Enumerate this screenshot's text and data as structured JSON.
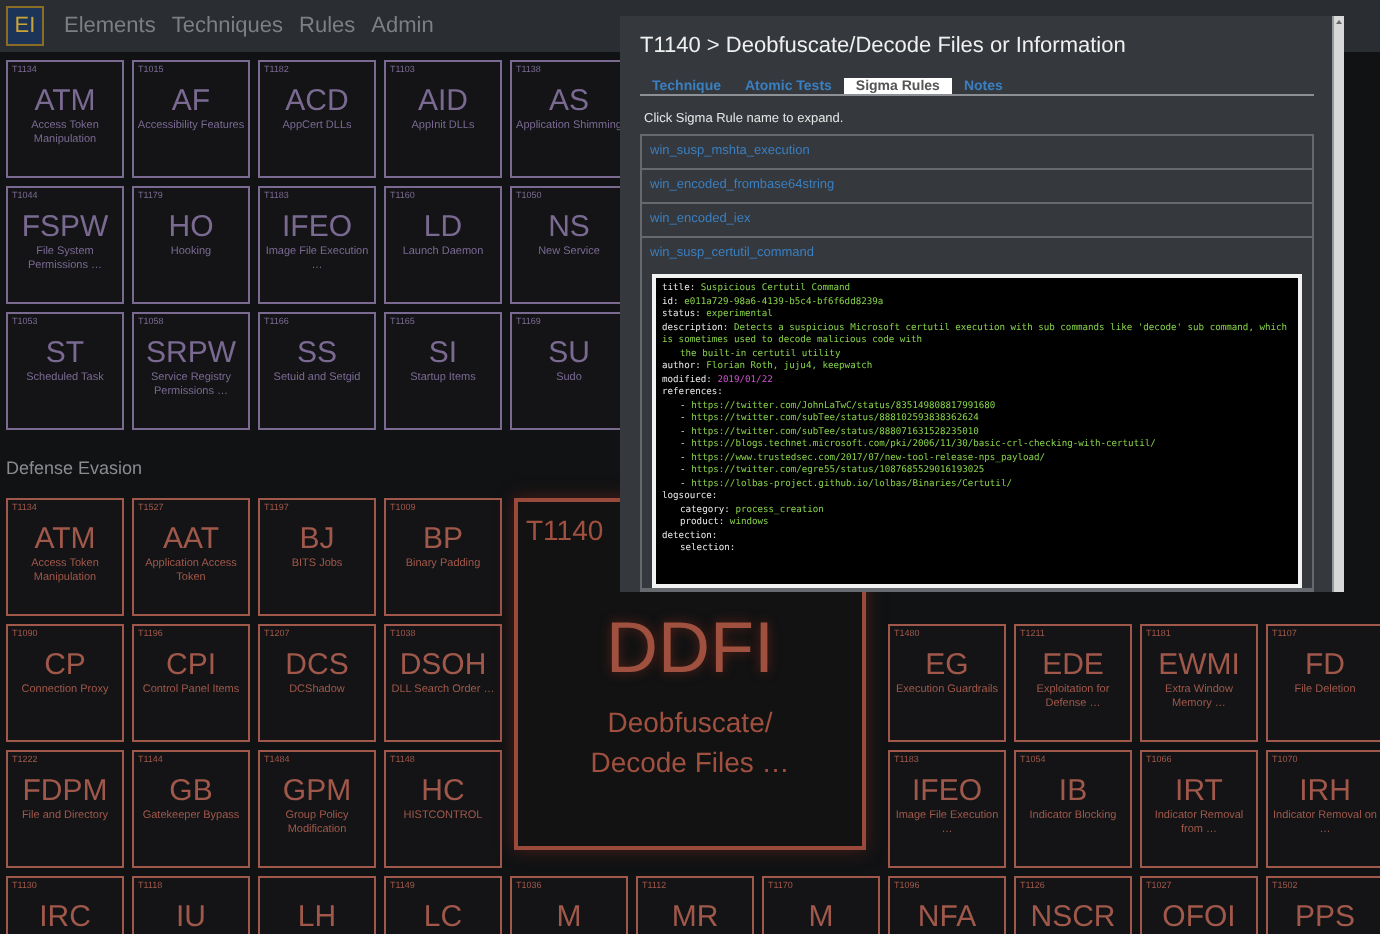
{
  "nav": {
    "logo": "EI",
    "items": [
      "Elements",
      "Techniques",
      "Rules",
      "Admin"
    ]
  },
  "sections": [
    {
      "color": "#7a6a92",
      "rows": [
        {
          "left": [
            {
              "id": "T1134",
              "abbr": "ATM",
              "name": "Access Token Manipulation"
            },
            {
              "id": "T1015",
              "abbr": "AF",
              "name": "Accessibility Features"
            },
            {
              "id": "T1182",
              "abbr": "ACD",
              "name": "AppCert DLLs"
            },
            {
              "id": "T1103",
              "abbr": "AID",
              "name": "AppInit DLLs"
            },
            {
              "id": "T1138",
              "abbr": "AS",
              "name": "Application Shimming"
            }
          ]
        },
        {
          "left": [
            {
              "id": "T1044",
              "abbr": "FSPW",
              "name": "File System Permissions …"
            },
            {
              "id": "T1179",
              "abbr": "HO",
              "name": "Hooking"
            },
            {
              "id": "T1183",
              "abbr": "IFEO",
              "name": "Image File Execution …"
            },
            {
              "id": "T1160",
              "abbr": "LD",
              "name": "Launch Daemon"
            },
            {
              "id": "T1050",
              "abbr": "NS",
              "name": "New Service"
            }
          ]
        },
        {
          "left": [
            {
              "id": "T1053",
              "abbr": "ST",
              "name": "Scheduled Task"
            },
            {
              "id": "T1058",
              "abbr": "SRPW",
              "name": "Service Registry Permissions …"
            },
            {
              "id": "T1166",
              "abbr": "SS",
              "name": "Setuid and Setgid"
            },
            {
              "id": "T1165",
              "abbr": "SI",
              "name": "Startup Items"
            },
            {
              "id": "T1169",
              "abbr": "SU",
              "name": "Sudo"
            }
          ]
        }
      ]
    },
    {
      "heading": "Defense Evasion",
      "color": "#a0584a",
      "rows": [
        {
          "left": [
            {
              "id": "T1134",
              "abbr": "ATM",
              "name": "Access Token Manipulation"
            },
            {
              "id": "T1527",
              "abbr": "AAT",
              "name": "Application Access Token"
            },
            {
              "id": "T1197",
              "abbr": "BJ",
              "name": "BITS Jobs"
            },
            {
              "id": "T1009",
              "abbr": "BP",
              "name": "Binary Padding"
            }
          ]
        },
        {
          "left": [
            {
              "id": "T1090",
              "abbr": "CP",
              "name": "Connection Proxy"
            },
            {
              "id": "T1196",
              "abbr": "CPI",
              "name": "Control Panel Items"
            },
            {
              "id": "T1207",
              "abbr": "DCS",
              "name": "DCShadow"
            },
            {
              "id": "T1038",
              "abbr": "DSOH",
              "name": "DLL Search Order …"
            }
          ],
          "right": [
            {
              "id": "T1480",
              "abbr": "EG",
              "name": "Execution Guardrails"
            },
            {
              "id": "T1211",
              "abbr": "EDE",
              "name": "Exploitation for Defense …"
            },
            {
              "id": "T1181",
              "abbr": "EWMI",
              "name": "Extra Window Memory …"
            },
            {
              "id": "T1107",
              "abbr": "FD",
              "name": "File Deletion"
            }
          ]
        },
        {
          "left": [
            {
              "id": "T1222",
              "abbr": "FDPM",
              "name": "File and Directory"
            },
            {
              "id": "T1144",
              "abbr": "GB",
              "name": "Gatekeeper Bypass"
            },
            {
              "id": "T1484",
              "abbr": "GPM",
              "name": "Group Policy Modification"
            },
            {
              "id": "T1148",
              "abbr": "HC",
              "name": "HISTCONTROL"
            }
          ],
          "right": [
            {
              "id": "T1183",
              "abbr": "IFEO",
              "name": "Image File Execution …"
            },
            {
              "id": "T1054",
              "abbr": "IB",
              "name": "Indicator Blocking"
            },
            {
              "id": "T1066",
              "abbr": "IRT",
              "name": "Indicator Removal from …"
            },
            {
              "id": "T1070",
              "abbr": "IRH",
              "name": "Indicator Removal on …"
            }
          ]
        },
        {
          "left": [
            {
              "id": "T1130",
              "abbr": "IRC"
            },
            {
              "id": "T1118",
              "abbr": "IU"
            },
            {
              "abbr": "LH"
            },
            {
              "id": "T1149",
              "abbr": "LC"
            },
            {
              "id": "T1036",
              "abbr": "M"
            },
            {
              "id": "T1112",
              "abbr": "MR"
            },
            {
              "id": "T1170",
              "abbr": "M"
            },
            {
              "id": "T1096",
              "abbr": "NFA"
            },
            {
              "id": "T1126",
              "abbr": "NSCR"
            },
            {
              "id": "T1027",
              "abbr": "OFOI"
            },
            {
              "id": "T1502",
              "abbr": "PPS"
            }
          ]
        }
      ]
    }
  ],
  "focused_tile": {
    "id": "T1140",
    "abbr": "DDFI",
    "name": "Deobfuscate/ Decode Files …"
  },
  "dialog": {
    "title": "T1140 > Deobfuscate/Decode Files or Information",
    "tabs": [
      {
        "label": "Technique",
        "selected": false
      },
      {
        "label": "Atomic Tests",
        "selected": false
      },
      {
        "label": "Sigma Rules",
        "selected": true
      },
      {
        "label": "Notes",
        "selected": false
      }
    ],
    "hint": "Click Sigma Rule name to expand.",
    "rules": [
      {
        "name": "win_susp_mshta_execution",
        "expanded": false
      },
      {
        "name": "win_encoded_frombase64string",
        "expanded": false
      },
      {
        "name": "win_encoded_iex",
        "expanded": false
      },
      {
        "name": "win_susp_certutil_command",
        "expanded": true,
        "code": [
          {
            "key": "title:",
            "value": "Suspicious Certutil Command",
            "kind": "string"
          },
          {
            "key": "id:",
            "value": "e011a729-98a6-4139-b5c4-bf6f6dd8239a",
            "kind": "string"
          },
          {
            "key": "status:",
            "value": "experimental",
            "kind": "string"
          },
          {
            "key": "description:",
            "value": "Detects a suspicious Microsoft certutil execution with sub commands like 'decode' sub command, which is sometimes used to decode malicious code with",
            "kind": "string",
            "children": [
              {
                "value": "the built-in certutil utility",
                "kind": "string"
              }
            ]
          },
          {
            "key": "author:",
            "value": "Florian Roth, juju4, keepwatch",
            "kind": "string"
          },
          {
            "key": "modified:",
            "value": "2019/01/22",
            "kind": "date"
          },
          {
            "key": "references:",
            "children": [
              {
                "key": "-",
                "value": "https://twitter.com/JohnLaTwC/status/835149808817991680",
                "kind": "string"
              },
              {
                "key": "-",
                "value": "https://twitter.com/subTee/status/888102593838362624",
                "kind": "string"
              },
              {
                "key": "-",
                "value": "https://twitter.com/subTee/status/888071631528235010",
                "kind": "string"
              },
              {
                "key": "-",
                "value": "https://blogs.technet.microsoft.com/pki/2006/11/30/basic-crl-checking-with-certutil/",
                "kind": "string"
              },
              {
                "key": "-",
                "value": "https://www.trustedsec.com/2017/07/new-tool-release-nps_payload/",
                "kind": "string"
              },
              {
                "key": "-",
                "value": "https://twitter.com/egre55/status/1087685529016193025",
                "kind": "string"
              },
              {
                "key": "-",
                "value": "https://lolbas-project.github.io/lolbas/Binaries/Certutil/",
                "kind": "string"
              }
            ]
          },
          {
            "key": "logsource:",
            "children": [
              {
                "key": "category:",
                "value": "process_creation",
                "kind": "string"
              },
              {
                "key": "product:",
                "value": "windows",
                "kind": "string"
              }
            ]
          },
          {
            "key": "detection:",
            "children": [
              {
                "key": "selection:"
              }
            ]
          }
        ]
      }
    ]
  }
}
